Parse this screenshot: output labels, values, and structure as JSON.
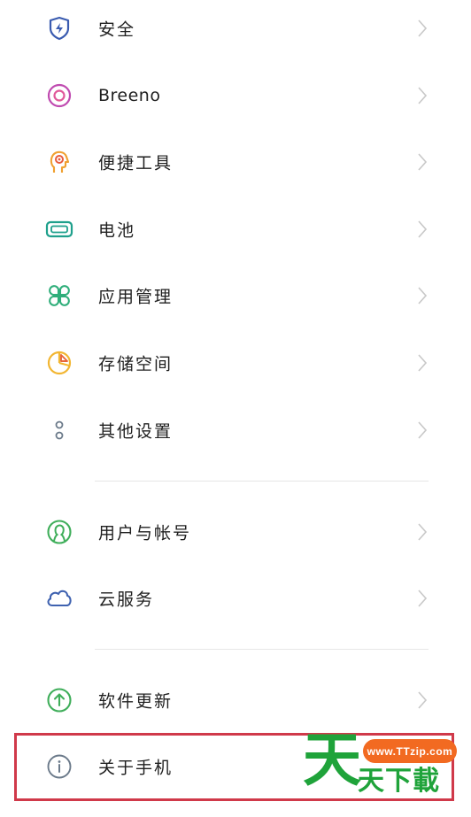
{
  "settings": {
    "group1": [
      {
        "label": "安全",
        "icon": "shield-icon"
      },
      {
        "label": "Breeno",
        "icon": "breeno-icon"
      },
      {
        "label": "便捷工具",
        "icon": "head-gear-icon"
      },
      {
        "label": "电池",
        "icon": "battery-icon"
      },
      {
        "label": "应用管理",
        "icon": "apps-grid-icon"
      },
      {
        "label": "存储空间",
        "icon": "pie-chart-icon"
      },
      {
        "label": "其他设置",
        "icon": "more-dots-icon"
      }
    ],
    "group2": [
      {
        "label": "用户与帐号",
        "icon": "user-icon"
      },
      {
        "label": "云服务",
        "icon": "cloud-icon"
      }
    ],
    "group3": [
      {
        "label": "软件更新",
        "icon": "update-arrow-icon"
      },
      {
        "label": "关于手机",
        "icon": "info-icon"
      }
    ]
  },
  "watermark": {
    "url": "www.TTzip.com",
    "big_char": "天",
    "small_text": "天下載"
  },
  "colors": {
    "highlight_border": "#d0394a",
    "watermark_green": "#1fa33a",
    "watermark_orange": "#f26a21"
  }
}
